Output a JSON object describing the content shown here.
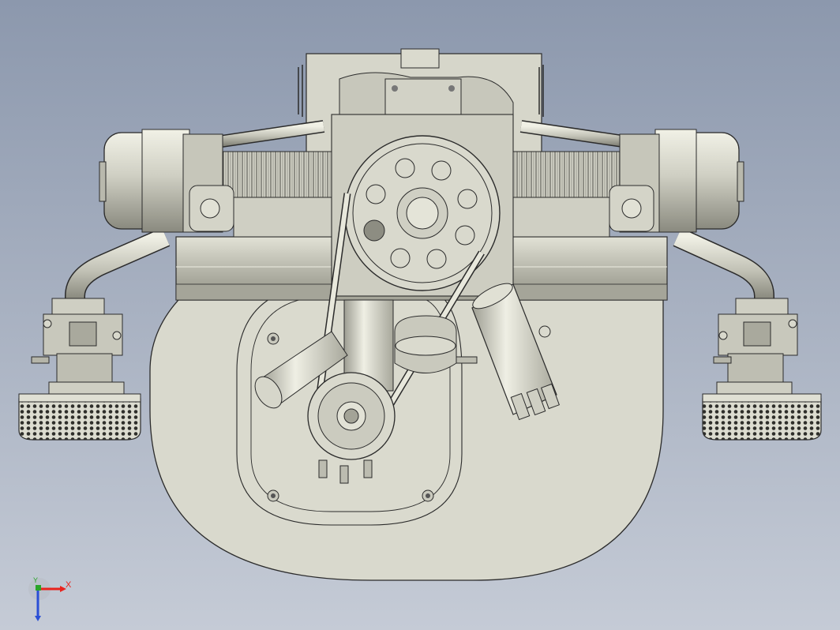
{
  "viewport": {
    "background_top": "#8c98ad",
    "background_bottom": "#c5cbd6"
  },
  "model": {
    "part_fill": "#d8d8cc",
    "edge_color": "#2b2b2b",
    "shade_color": "#9c9c90"
  },
  "triad": {
    "x_label": "X",
    "y_label": "Y",
    "x_color": "#e8231d",
    "y_color": "#2aa52a",
    "z_color": "#2a4fd6"
  }
}
